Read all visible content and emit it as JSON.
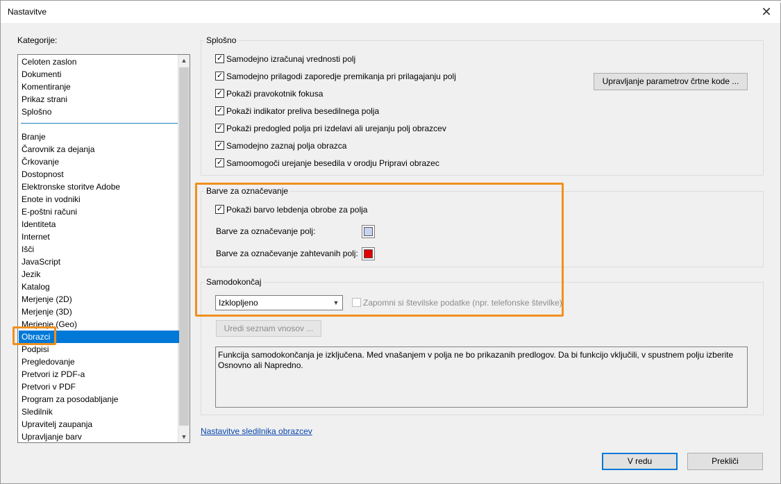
{
  "window": {
    "title": "Nastavitve",
    "close_glyph": "✕"
  },
  "categories": {
    "label": "Kategorije:",
    "top_items": [
      "Celoten zaslon",
      "Dokumenti",
      "Komentiranje",
      "Prikaz strani",
      "Splošno"
    ],
    "items": [
      "Branje",
      "Čarovnik za dejanja",
      "Črkovanje",
      "Dostopnost",
      "Elektronske storitve Adobe",
      "Enote in vodniki",
      "E-poštni računi",
      "Identiteta",
      "Internet",
      "Išči",
      "JavaScript",
      "Jezik",
      "Katalog",
      "Merjenje (2D)",
      "Merjenje (3D)",
      "Merjenje (Geo)",
      "Obrazci",
      "Podpisi",
      "Pregledovanje",
      "Pretvori iz PDF-a",
      "Pretvori v PDF",
      "Program za posodabljanje",
      "Sledilnik",
      "Upravitelj zaupanja",
      "Upravljanje barv"
    ],
    "selected": "Obrazci"
  },
  "general": {
    "title": "Splošno",
    "options": [
      {
        "label": "Samodejno izračunaj vrednosti polj",
        "checked": true
      },
      {
        "label": "Samodejno prilagodi zaporedje premikanja pri prilagajanju polj",
        "checked": true
      },
      {
        "label": "Pokaži pravokotnik fokusa",
        "checked": true
      },
      {
        "label": "Pokaži indikator preliva besedilnega polja",
        "checked": true
      },
      {
        "label": "Pokaži predogled polja pri izdelavi ali urejanju polj obrazcev",
        "checked": true
      },
      {
        "label": "Samodejno zaznaj polja obrazca",
        "checked": true
      },
      {
        "label": "Samoomogoči urejanje besedila v orodju Pripravi obrazec",
        "checked": true
      }
    ],
    "barcode_button": "Upravljanje parametrov črtne kode ..."
  },
  "highlight": {
    "title": "Barve za označevanje",
    "hover_border": {
      "label": "Pokaži barvo lebdenja obrobe za polja",
      "checked": true
    },
    "field_color_label": "Barve za označevanje polj:",
    "field_color": "#c8d2f5",
    "required_color_label": "Barve za označevanje zahtevanih polj:",
    "required_color": "#e00000"
  },
  "autocomplete": {
    "title": "Samodokončaj",
    "mode": "Izklopljeno",
    "remember_numeric": {
      "label": "Zapomni si številske podatke (npr. telefonske številke)",
      "checked": false
    },
    "edit_entries_button": "Uredi seznam vnosov ...",
    "description": "Funkcija samodokončanja je izključena. Med vnašanjem v polja ne bo prikazanih predlogov. Da bi funkcijo vključili, v spustnem polju izberite Osnovno ali Napredno."
  },
  "tracker_link": "Nastavitve sledilnika obrazcev",
  "buttons": {
    "ok": "V redu",
    "cancel": "Prekliči"
  },
  "glyphs": {
    "check": "✓",
    "scroll_up": "▲",
    "scroll_down": "▼",
    "dropdown": "▼"
  },
  "colors": {
    "accent": "#0078d7",
    "annotation": "#f0901e",
    "link": "#0645ad"
  }
}
